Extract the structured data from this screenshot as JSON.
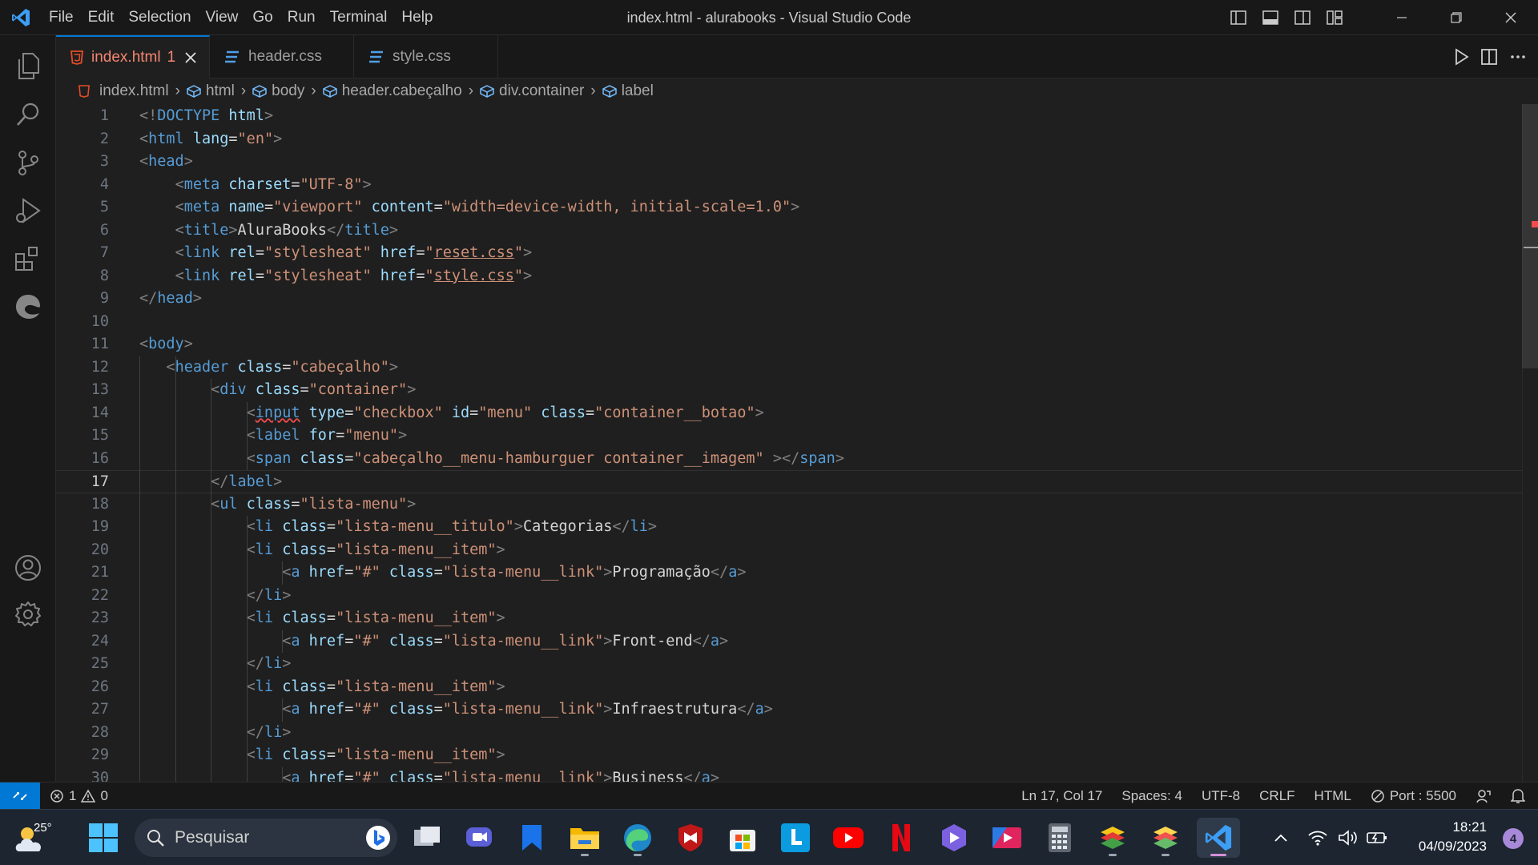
{
  "window": {
    "title": "index.html - alurabooks - Visual Studio Code",
    "menu": [
      "File",
      "Edit",
      "Selection",
      "View",
      "Go",
      "Run",
      "Terminal",
      "Help"
    ]
  },
  "tabs": [
    {
      "label": "index.html",
      "badge": "1",
      "icon": "html5-icon",
      "active": true,
      "color": "#f48771"
    },
    {
      "label": "header.css",
      "icon": "css3-icon",
      "active": false
    },
    {
      "label": "style.css",
      "icon": "css3-icon",
      "active": false
    }
  ],
  "breadcrumb": [
    "index.html",
    "html",
    "body",
    "header.cabeçalho",
    "div.container",
    "label"
  ],
  "editor": {
    "current_line": 17,
    "line_numbers": [
      "1",
      "2",
      "3",
      "4",
      "5",
      "6",
      "7",
      "8",
      "9",
      "10",
      "11",
      "12",
      "13",
      "14",
      "15",
      "16",
      "17",
      "18",
      "19",
      "20",
      "21",
      "22",
      "23",
      "24",
      "25",
      "26",
      "27",
      "28",
      "29",
      "30"
    ],
    "lines": [
      [
        [
          "b",
          "<!"
        ],
        [
          "t",
          "DOCTYPE"
        ],
        [
          "x",
          " "
        ],
        [
          "a",
          "html"
        ],
        [
          "b",
          ">"
        ]
      ],
      [
        [
          "b",
          "<"
        ],
        [
          "t",
          "html"
        ],
        [
          "x",
          " "
        ],
        [
          "a",
          "lang"
        ],
        [
          "x",
          "="
        ],
        [
          "s",
          "\"en\""
        ],
        [
          "b",
          ">"
        ]
      ],
      [
        [
          "b",
          "<"
        ],
        [
          "t",
          "head"
        ],
        [
          "b",
          ">"
        ]
      ],
      [
        [
          "x",
          "    "
        ],
        [
          "b",
          "<"
        ],
        [
          "t",
          "meta"
        ],
        [
          "x",
          " "
        ],
        [
          "a",
          "charset"
        ],
        [
          "x",
          "="
        ],
        [
          "s",
          "\"UTF-8\""
        ],
        [
          "b",
          ">"
        ]
      ],
      [
        [
          "x",
          "    "
        ],
        [
          "b",
          "<"
        ],
        [
          "t",
          "meta"
        ],
        [
          "x",
          " "
        ],
        [
          "a",
          "name"
        ],
        [
          "x",
          "="
        ],
        [
          "s",
          "\"viewport\""
        ],
        [
          "x",
          " "
        ],
        [
          "a",
          "content"
        ],
        [
          "x",
          "="
        ],
        [
          "s",
          "\"width=device-width, initial-scale=1.0\""
        ],
        [
          "b",
          ">"
        ]
      ],
      [
        [
          "x",
          "    "
        ],
        [
          "b",
          "<"
        ],
        [
          "t",
          "title"
        ],
        [
          "b",
          ">"
        ],
        [
          "x",
          "AluraBooks"
        ],
        [
          "b",
          "</"
        ],
        [
          "t",
          "title"
        ],
        [
          "b",
          ">"
        ]
      ],
      [
        [
          "x",
          "    "
        ],
        [
          "b",
          "<"
        ],
        [
          "t",
          "link"
        ],
        [
          "x",
          " "
        ],
        [
          "a",
          "rel"
        ],
        [
          "x",
          "="
        ],
        [
          "s",
          "\"stylesheat\""
        ],
        [
          "x",
          " "
        ],
        [
          "a",
          "href"
        ],
        [
          "x",
          "="
        ],
        [
          "s",
          "\""
        ],
        [
          "su",
          "reset.css"
        ],
        [
          "s",
          "\""
        ],
        [
          "b",
          ">"
        ]
      ],
      [
        [
          "x",
          "    "
        ],
        [
          "b",
          "<"
        ],
        [
          "t",
          "link"
        ],
        [
          "x",
          " "
        ],
        [
          "a",
          "rel"
        ],
        [
          "x",
          "="
        ],
        [
          "s",
          "\"stylesheat\""
        ],
        [
          "x",
          " "
        ],
        [
          "a",
          "href"
        ],
        [
          "x",
          "="
        ],
        [
          "s",
          "\""
        ],
        [
          "su",
          "style.css"
        ],
        [
          "s",
          "\""
        ],
        [
          "b",
          ">"
        ]
      ],
      [
        [
          "b",
          "</"
        ],
        [
          "t",
          "head"
        ],
        [
          "b",
          ">"
        ]
      ],
      [],
      [
        [
          "b",
          "<"
        ],
        [
          "t",
          "body"
        ],
        [
          "b",
          ">"
        ]
      ],
      [
        [
          "x",
          "   "
        ],
        [
          "b",
          "<"
        ],
        [
          "t",
          "header"
        ],
        [
          "x",
          " "
        ],
        [
          "a",
          "class"
        ],
        [
          "x",
          "="
        ],
        [
          "s",
          "\"cabeçalho\""
        ],
        [
          "b",
          ">"
        ]
      ],
      [
        [
          "x",
          "        "
        ],
        [
          "b",
          "<"
        ],
        [
          "t",
          "div"
        ],
        [
          "x",
          " "
        ],
        [
          "a",
          "class"
        ],
        [
          "x",
          "="
        ],
        [
          "s",
          "\"container\""
        ],
        [
          "b",
          ">"
        ]
      ],
      [
        [
          "x",
          "            "
        ],
        [
          "b",
          "<"
        ],
        [
          "tw",
          "input"
        ],
        [
          "x",
          " "
        ],
        [
          "a",
          "type"
        ],
        [
          "x",
          "="
        ],
        [
          "s",
          "\"checkbox\""
        ],
        [
          "x",
          " "
        ],
        [
          "a",
          "id"
        ],
        [
          "x",
          "="
        ],
        [
          "s",
          "\"menu\""
        ],
        [
          "x",
          " "
        ],
        [
          "a",
          "class"
        ],
        [
          "x",
          "="
        ],
        [
          "s",
          "\"container__botao\""
        ],
        [
          "b",
          ">"
        ]
      ],
      [
        [
          "x",
          "            "
        ],
        [
          "b",
          "<"
        ],
        [
          "t",
          "label"
        ],
        [
          "x",
          " "
        ],
        [
          "a",
          "for"
        ],
        [
          "x",
          "="
        ],
        [
          "s",
          "\"menu\""
        ],
        [
          "b",
          ">"
        ]
      ],
      [
        [
          "x",
          "            "
        ],
        [
          "b",
          "<"
        ],
        [
          "t",
          "span"
        ],
        [
          "x",
          " "
        ],
        [
          "a",
          "class"
        ],
        [
          "x",
          "="
        ],
        [
          "s",
          "\"cabeçalho__menu-hamburguer container__imagem\""
        ],
        [
          "x",
          " "
        ],
        [
          "b",
          "></"
        ],
        [
          "t",
          "span"
        ],
        [
          "b",
          ">"
        ]
      ],
      [
        [
          "x",
          "        "
        ],
        [
          "b",
          "</"
        ],
        [
          "t",
          "label"
        ],
        [
          "b",
          ">"
        ]
      ],
      [
        [
          "x",
          "        "
        ],
        [
          "b",
          "<"
        ],
        [
          "t",
          "ul"
        ],
        [
          "x",
          " "
        ],
        [
          "a",
          "class"
        ],
        [
          "x",
          "="
        ],
        [
          "s",
          "\"lista-menu\""
        ],
        [
          "b",
          ">"
        ]
      ],
      [
        [
          "x",
          "            "
        ],
        [
          "b",
          "<"
        ],
        [
          "t",
          "li"
        ],
        [
          "x",
          " "
        ],
        [
          "a",
          "class"
        ],
        [
          "x",
          "="
        ],
        [
          "s",
          "\"lista-menu__titulo\""
        ],
        [
          "b",
          ">"
        ],
        [
          "x",
          "Categorias"
        ],
        [
          "b",
          "</"
        ],
        [
          "t",
          "li"
        ],
        [
          "b",
          ">"
        ]
      ],
      [
        [
          "x",
          "            "
        ],
        [
          "b",
          "<"
        ],
        [
          "t",
          "li"
        ],
        [
          "x",
          " "
        ],
        [
          "a",
          "class"
        ],
        [
          "x",
          "="
        ],
        [
          "s",
          "\"lista-menu__item\""
        ],
        [
          "b",
          ">"
        ]
      ],
      [
        [
          "x",
          "                "
        ],
        [
          "b",
          "<"
        ],
        [
          "t",
          "a"
        ],
        [
          "x",
          " "
        ],
        [
          "a",
          "href"
        ],
        [
          "x",
          "="
        ],
        [
          "s",
          "\"#\""
        ],
        [
          "x",
          " "
        ],
        [
          "a",
          "class"
        ],
        [
          "x",
          "="
        ],
        [
          "s",
          "\"lista-menu__link\""
        ],
        [
          "b",
          ">"
        ],
        [
          "x",
          "Programação"
        ],
        [
          "b",
          "</"
        ],
        [
          "t",
          "a"
        ],
        [
          "b",
          ">"
        ]
      ],
      [
        [
          "x",
          "            "
        ],
        [
          "b",
          "</"
        ],
        [
          "t",
          "li"
        ],
        [
          "b",
          ">"
        ]
      ],
      [
        [
          "x",
          "            "
        ],
        [
          "b",
          "<"
        ],
        [
          "t",
          "li"
        ],
        [
          "x",
          " "
        ],
        [
          "a",
          "class"
        ],
        [
          "x",
          "="
        ],
        [
          "s",
          "\"lista-menu__item\""
        ],
        [
          "b",
          ">"
        ]
      ],
      [
        [
          "x",
          "                "
        ],
        [
          "b",
          "<"
        ],
        [
          "t",
          "a"
        ],
        [
          "x",
          " "
        ],
        [
          "a",
          "href"
        ],
        [
          "x",
          "="
        ],
        [
          "s",
          "\"#\""
        ],
        [
          "x",
          " "
        ],
        [
          "a",
          "class"
        ],
        [
          "x",
          "="
        ],
        [
          "s",
          "\"lista-menu__link\""
        ],
        [
          "b",
          ">"
        ],
        [
          "x",
          "Front-end"
        ],
        [
          "b",
          "</"
        ],
        [
          "t",
          "a"
        ],
        [
          "b",
          ">"
        ]
      ],
      [
        [
          "x",
          "            "
        ],
        [
          "b",
          "</"
        ],
        [
          "t",
          "li"
        ],
        [
          "b",
          ">"
        ]
      ],
      [
        [
          "x",
          "            "
        ],
        [
          "b",
          "<"
        ],
        [
          "t",
          "li"
        ],
        [
          "x",
          " "
        ],
        [
          "a",
          "class"
        ],
        [
          "x",
          "="
        ],
        [
          "s",
          "\"lista-menu__item\""
        ],
        [
          "b",
          ">"
        ]
      ],
      [
        [
          "x",
          "                "
        ],
        [
          "b",
          "<"
        ],
        [
          "t",
          "a"
        ],
        [
          "x",
          " "
        ],
        [
          "a",
          "href"
        ],
        [
          "x",
          "="
        ],
        [
          "s",
          "\"#\""
        ],
        [
          "x",
          " "
        ],
        [
          "a",
          "class"
        ],
        [
          "x",
          "="
        ],
        [
          "s",
          "\"lista-menu__link\""
        ],
        [
          "b",
          ">"
        ],
        [
          "x",
          "Infraestrutura"
        ],
        [
          "b",
          "</"
        ],
        [
          "t",
          "a"
        ],
        [
          "b",
          ">"
        ]
      ],
      [
        [
          "x",
          "            "
        ],
        [
          "b",
          "</"
        ],
        [
          "t",
          "li"
        ],
        [
          "b",
          ">"
        ]
      ],
      [
        [
          "x",
          "            "
        ],
        [
          "b",
          "<"
        ],
        [
          "t",
          "li"
        ],
        [
          "x",
          " "
        ],
        [
          "a",
          "class"
        ],
        [
          "x",
          "="
        ],
        [
          "s",
          "\"lista-menu__item\""
        ],
        [
          "b",
          ">"
        ]
      ],
      [
        [
          "x",
          "                "
        ],
        [
          "b",
          "<"
        ],
        [
          "t",
          "a"
        ],
        [
          "x",
          " "
        ],
        [
          "a",
          "href"
        ],
        [
          "x",
          "="
        ],
        [
          "s",
          "\"#\""
        ],
        [
          "x",
          " "
        ],
        [
          "a",
          "class"
        ],
        [
          "x",
          "="
        ],
        [
          "s",
          "\"lista-menu__link\""
        ],
        [
          "b",
          ">"
        ],
        [
          "x",
          "Business"
        ],
        [
          "b",
          "</"
        ],
        [
          "t",
          "a"
        ],
        [
          "b",
          ">"
        ]
      ]
    ]
  },
  "statusbar": {
    "errors": "1",
    "warnings": "0",
    "position": "Ln 17, Col 17",
    "spaces": "Spaces: 4",
    "encoding": "UTF-8",
    "eol": "CRLF",
    "language": "HTML",
    "port": "Port : 5500"
  },
  "taskbar": {
    "weather_temp": "25°",
    "search_placeholder": "Pesquisar",
    "time": "18:21",
    "date": "04/09/2023",
    "notifications": "4",
    "apps": [
      "task-view",
      "chat",
      "bookmark-app",
      "file-explorer",
      "edge",
      "mcafee",
      "microsoft-store",
      "l-app",
      "youtube",
      "netflix",
      "prime-app",
      "media-app",
      "calculator",
      "bluestacks",
      "bluestacks-x",
      "vscode"
    ]
  },
  "colors": {
    "accent": "#0078d4",
    "error": "#f14c4c",
    "tag": "#569cd6",
    "attribute": "#9cdcfe",
    "string": "#ce9178"
  }
}
